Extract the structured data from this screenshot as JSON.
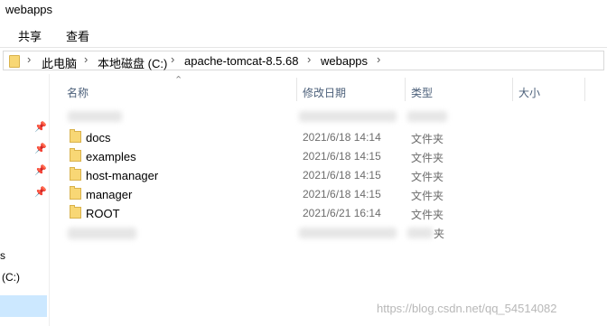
{
  "window": {
    "title": "webapps"
  },
  "ribbon": {
    "tabs": [
      "共享",
      "查看"
    ]
  },
  "address": {
    "segments": [
      "此电脑",
      "本地磁盘 (C:)",
      "apache-tomcat-8.5.68",
      "webapps"
    ],
    "separator": "›"
  },
  "columns": {
    "name": "名称",
    "date": "修改日期",
    "type": "类型",
    "size": "大小"
  },
  "files": [
    {
      "name": "docs",
      "date": "2021/6/18 14:14",
      "type": "文件夹"
    },
    {
      "name": "examples",
      "date": "2021/6/18 14:15",
      "type": "文件夹"
    },
    {
      "name": "host-manager",
      "date": "2021/6/18 14:15",
      "type": "文件夹"
    },
    {
      "name": "manager",
      "date": "2021/6/18 14:15",
      "type": "文件夹"
    },
    {
      "name": "ROOT",
      "date": "2021/6/21 16:14",
      "type": "文件夹"
    }
  ],
  "partial_row": {
    "type_fragment": "夹"
  },
  "sidebar": {
    "item_s": "s",
    "drive": "(C:)"
  },
  "watermark": "https://blog.csdn.net/qq_54514082",
  "icons": [
    "folder-icon",
    "pin-icon",
    "sort-up-icon",
    "chevron-right-icon"
  ]
}
